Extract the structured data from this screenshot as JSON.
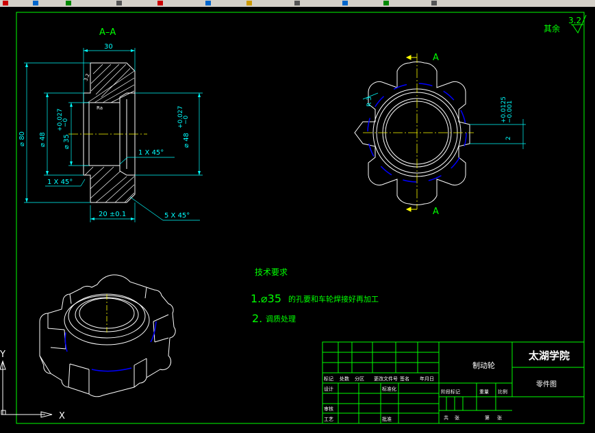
{
  "drawing": {
    "section_label": "A–A",
    "view_label_top": "A",
    "view_label_bottom": "A",
    "roughness_label": "其余",
    "roughness_value": "3.2",
    "dims": {
      "width_30": "30",
      "dia_80": "⌀ 80",
      "dia_48_left": "⌀ 48",
      "tol_left_upper": "+0.027",
      "tol_left_lower": "−0",
      "dia_35": "⌀ 35",
      "chamfer_small_mid": "1 X 45°",
      "chamfer_small_left": "1 X 45°",
      "dia_48_right": "⌀ 48",
      "tol_right_upper": "+0.027",
      "tol_right_lower": "−0",
      "dim_20": "20 ±0.1",
      "chamfer_large": "5 X 45°",
      "radius": "R 3",
      "keyway_tol_upper": "+0.0125",
      "keyway_tol_lower": "−0.001",
      "keyway_2": "2",
      "roughness_small": "3.2",
      "ra_center": "Ra"
    },
    "notes": {
      "heading": "技术要求",
      "item1_num": "1.",
      "item1_sym": "⌀35",
      "item1_text": "的孔要和车轮焊接好再加工",
      "item2_num": "2.",
      "item2_text": "调质处理"
    },
    "ucs": {
      "x": "X",
      "y": "Y"
    }
  },
  "title_block": {
    "part_name": "制动轮",
    "school": "太湖学院",
    "drawing_type": "零件图",
    "row_labels": [
      "标记",
      "处数",
      "分区",
      "更改文件号",
      "签名",
      "年月日"
    ],
    "design": "设计",
    "standardization": "标准化",
    "stage_mark": "阶段标记",
    "weight": "重量",
    "scale": "比例",
    "review": "审核",
    "process": "工艺",
    "approve": "批准",
    "total": "共",
    "sheet_unit1": "张",
    "page": "第",
    "sheet_unit2": "张"
  },
  "colors": {
    "background": "#000000",
    "border": "#00ff00",
    "geometry": "#ffffff",
    "dimension": "#00ffff",
    "centerline": "#ffff00",
    "hidden": "#0000ff",
    "note": "#00ff00"
  }
}
